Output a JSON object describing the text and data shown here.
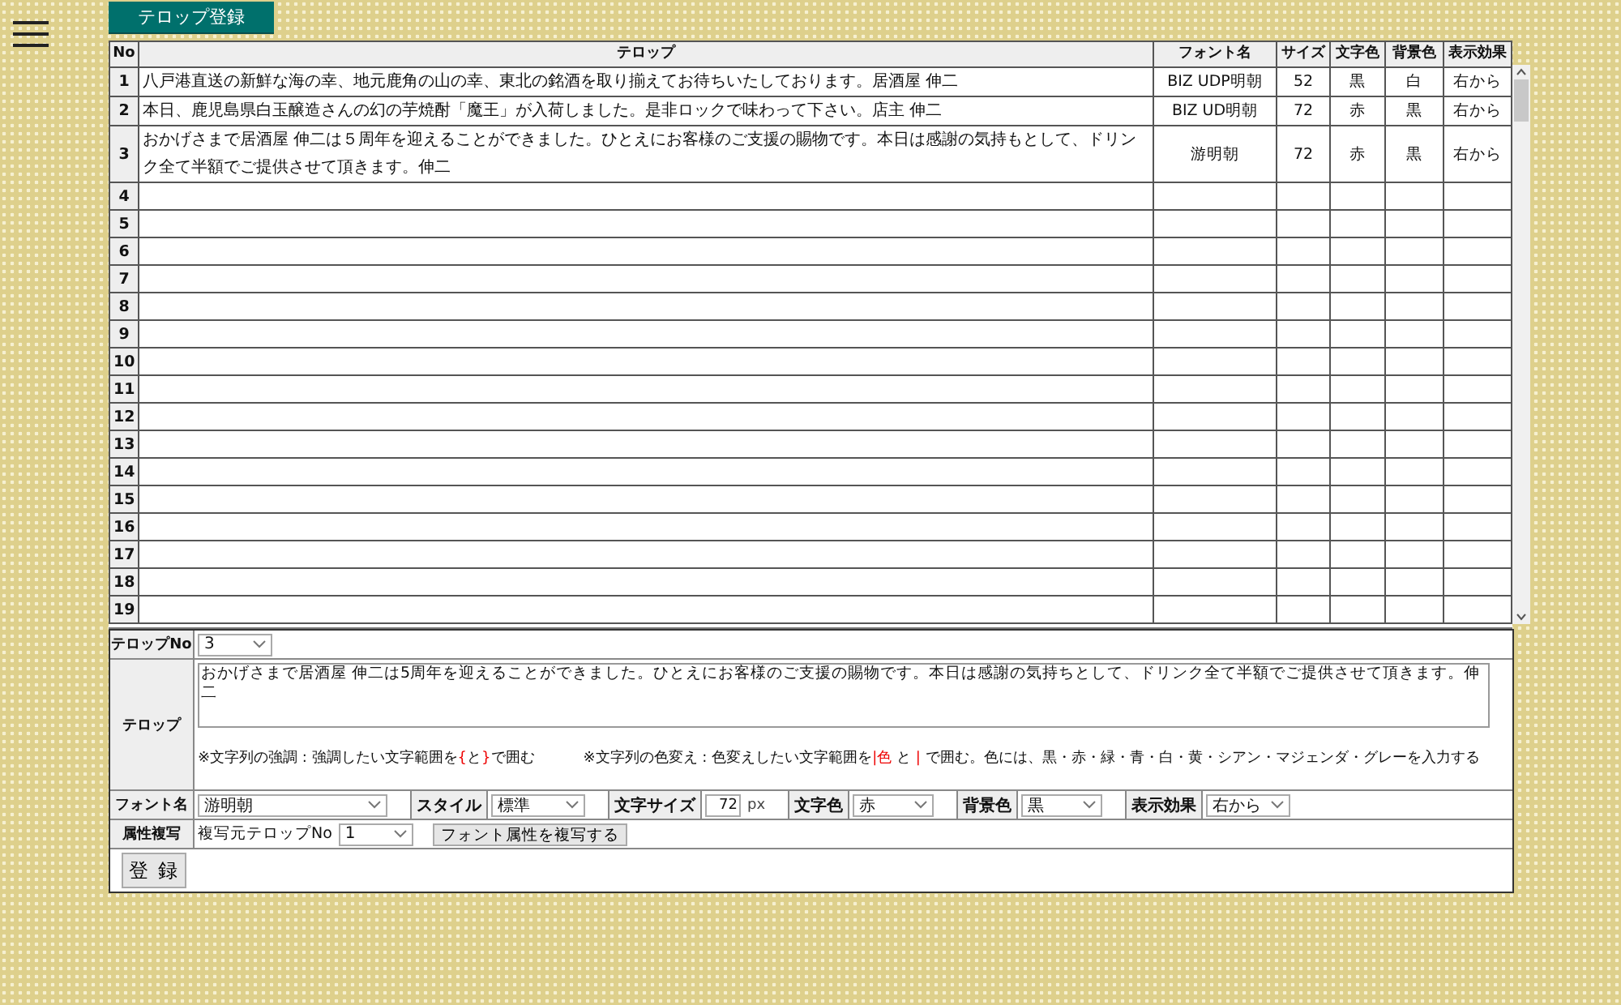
{
  "page_title": "テロップ登録",
  "table": {
    "columns": [
      "No",
      "テロップ",
      "フォント名",
      "サイズ",
      "文字色",
      "背景色",
      "表示効果"
    ],
    "rows": [
      {
        "no": "1",
        "telop": "八戸港直送の新鮮な海の幸、地元鹿角の山の幸、東北の銘酒を取り揃えてお待ちいたしております。居酒屋 伸二",
        "font": "BIZ UDP明朝",
        "size": "52",
        "text_color": "黒",
        "bg_color": "白",
        "effect": "右から"
      },
      {
        "no": "2",
        "telop": "本日、鹿児島県白玉醸造さんの幻の芋焼酎「魔王」が入荷しました。是非ロックで味わって下さい。店主 伸二",
        "font": "BIZ UD明朝",
        "size": "72",
        "text_color": "赤",
        "bg_color": "黒",
        "effect": "右から"
      },
      {
        "no": "3",
        "telop": "おかげさまで居酒屋 伸二は５周年を迎えることができました。ひとえにお客様のご支援の賜物です。本日は感謝の気持もとして、ドリンク全て半額でご提供させて頂きます。伸二",
        "font": "游明朝",
        "size": "72",
        "text_color": "赤",
        "bg_color": "黒",
        "effect": "右から"
      },
      {
        "no": "4"
      },
      {
        "no": "5"
      },
      {
        "no": "6"
      },
      {
        "no": "7"
      },
      {
        "no": "8"
      },
      {
        "no": "9"
      },
      {
        "no": "10"
      },
      {
        "no": "11"
      },
      {
        "no": "12"
      },
      {
        "no": "13"
      },
      {
        "no": "14"
      },
      {
        "no": "15"
      },
      {
        "no": "16"
      },
      {
        "no": "17"
      },
      {
        "no": "18"
      },
      {
        "no": "19"
      }
    ]
  },
  "form": {
    "telop_no": {
      "label": "テロップNo",
      "value": "3"
    },
    "telop": {
      "label": "テロップ",
      "value": "おかげさまで居酒屋 伸二は5周年を迎えることができました。ひとえにお客様のご支援の賜物です。本日は感謝の気持ちとして、ドリンク全て半額でご提供させて頂きます。伸二",
      "hints": [
        [
          {
            "text": "※文字列の強調 : 強調したい文字範囲を",
            "red": false
          },
          {
            "text": "{",
            "red": true
          },
          {
            "text": "と",
            "red": false
          },
          {
            "text": "}",
            "red": true
          },
          {
            "text": "で囲む",
            "red": false
          }
        ],
        [
          {
            "text": "※文字列の色変え : 色変えしたい文字範囲を",
            "red": false
          },
          {
            "text": "|色",
            "red": true
          },
          {
            "text": " と ",
            "red": false
          },
          {
            "text": "|",
            "red": true
          },
          {
            "text": " で囲む。色には、黒・赤・緑・青・白・黄・シアン・マジェンダ・グレーを入力する",
            "red": false
          }
        ]
      ]
    },
    "attributes": [
      {
        "label": "フォント名",
        "kind": "select",
        "value": "游明朝"
      },
      {
        "label": "スタイル",
        "kind": "select",
        "value": "標準"
      },
      {
        "label": "文字サイズ",
        "kind": "number",
        "value": "72",
        "unit": "px"
      },
      {
        "label": "文字色",
        "kind": "select",
        "value": "赤"
      },
      {
        "label": "背景色",
        "kind": "select",
        "value": "黒"
      },
      {
        "label": "表示効果",
        "kind": "select",
        "value": "右から"
      }
    ],
    "copy": {
      "label": "属性複写",
      "source_label": "複写元テロップNo",
      "value": "1",
      "button": "フォント属性を複写する"
    },
    "submit": "登 録"
  }
}
